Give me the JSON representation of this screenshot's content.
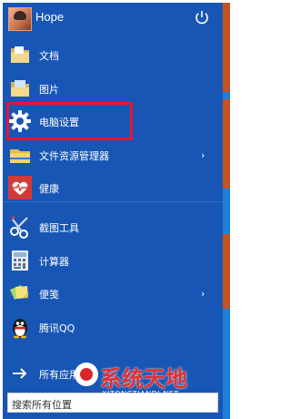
{
  "user": {
    "name": "Hope"
  },
  "menu_items": [
    {
      "label": "文档",
      "icon": "folder-icon"
    },
    {
      "label": "图片",
      "icon": "folder-icon"
    },
    {
      "label": "电脑设置",
      "icon": "gear-icon"
    },
    {
      "label": "文件资源管理器",
      "icon": "file-explorer-icon",
      "has_submenu": true
    },
    {
      "label": "健康",
      "icon": "heart-icon"
    },
    {
      "label": "截图工具",
      "icon": "scissors-icon"
    },
    {
      "label": "计算器",
      "icon": "calculator-icon"
    },
    {
      "label": "便笺",
      "icon": "sticky-notes-icon",
      "has_submenu": true
    },
    {
      "label": "腾讯QQ",
      "icon": "qq-penguin-icon"
    }
  ],
  "all_apps": {
    "label": "所有应用"
  },
  "search": {
    "placeholder": "搜索所有位置"
  },
  "submenu_glyph": "›",
  "watermark": {
    "title": "系统天地",
    "url": "XITONGTIANDI.NET"
  },
  "colors": {
    "menu_background": "#1856b5",
    "tile_orange": "#c6531f",
    "highlight_red": "#e8142f"
  }
}
